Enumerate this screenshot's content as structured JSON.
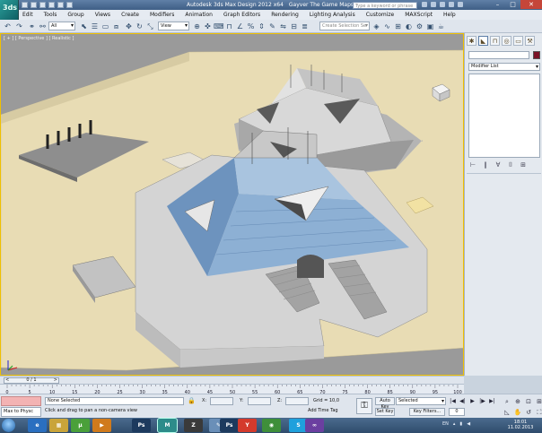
{
  "colors": {
    "title_bar": "#4a6a92",
    "viewport_bg": "#9a9a9a",
    "sand": "#e8dcb4",
    "pyramid_front_roof": "#8db0d4",
    "pyramid_back": "#d8d8d8",
    "active_viewport_border": "#f0c000",
    "object_color": "#7a1226"
  },
  "titlebar": {
    "app_icon_label": "3ds",
    "title": "Autodesk 3ds Max Design 2012 x64",
    "file": "Gayver The Game Maps 1.max",
    "search_placeholder": "Type a keyword or phrase",
    "window_buttons": {
      "minimize": "–",
      "maximize": "□",
      "close": "✕"
    }
  },
  "menu": [
    "Edit",
    "Tools",
    "Group",
    "Views",
    "Create",
    "Modifiers",
    "Animation",
    "Graph Editors",
    "Rendering",
    "Lighting Analysis",
    "Customize",
    "MAXScript",
    "Help"
  ],
  "toolbar": {
    "selection_filter": "All",
    "reference_coord": "View",
    "named_selection_placeholder": "Create Selection Se",
    "icons": [
      "undo-icon",
      "redo-icon",
      "select-link-icon",
      "unlink-icon",
      "bind-space-warp-icon",
      "select-icon",
      "select-by-name-icon",
      "rect-region-icon",
      "window-crossing-icon",
      "move-icon",
      "rotate-icon",
      "scale-icon",
      "pivot-icon",
      "select-manipulate-icon",
      "keyboard-shortcut-icon",
      "snaps-icon",
      "angle-snap-icon",
      "percent-snap-icon",
      "spinner-snap-icon",
      "edit-named-selection-icon",
      "mirror-icon",
      "align-icon",
      "layer-manager-icon",
      "graphite-icon",
      "curve-editor-icon",
      "schematic-view-icon",
      "material-editor-icon",
      "render-setup-icon",
      "rendered-frame-icon",
      "render-icon"
    ]
  },
  "viewport": {
    "label": "[ + ] [ Perspective ] [ Realistic ]"
  },
  "command_panel": {
    "tabs": [
      "create-tab",
      "modify-tab",
      "hierarchy-tab",
      "motion-tab",
      "display-tab",
      "utilities-tab"
    ],
    "modifier_list": "Modifier List",
    "stack_buttons": [
      "⊢",
      "‖",
      "∀",
      "⌷",
      "⊞"
    ]
  },
  "time_slider": {
    "position": "0 / 1"
  },
  "track_bar": {
    "ticks": [
      "0",
      "5",
      "10",
      "15",
      "20",
      "25",
      "30",
      "35",
      "40",
      "45",
      "50",
      "55",
      "60",
      "65",
      "70",
      "75",
      "80",
      "85",
      "90",
      "95",
      "100"
    ]
  },
  "status": {
    "listener_label": "Max to Physc",
    "selection": "None Selected",
    "prompt": "Click and drag to pan a non-camera view",
    "x_label": "X:",
    "y_label": "Y:",
    "z_label": "Z:",
    "grid": "Grid = 10,0",
    "add_time_tag": "Add Time Tag",
    "auto_key": "Auto Key",
    "set_key": "Set Key",
    "key_filters": "Key Filters...",
    "selected_set": "Selected",
    "frame": "0",
    "playback": [
      "|◀",
      "◀|",
      "▶",
      "|▶",
      "▶|"
    ],
    "nav_icons": [
      "zoom-icon",
      "zoom-all-icon",
      "zoom-extents-icon",
      "zoom-extents-all-icon",
      "fov-icon",
      "pan-icon",
      "orbit-icon",
      "maximize-viewport-icon"
    ]
  },
  "taskbar": {
    "apps": [
      "ie-icon",
      "explorer-icon",
      "utorrent-icon",
      "media-player-icon",
      "photoshop-icon",
      "3dsmax-icon",
      "zbrush-icon",
      "paint-icon",
      "photoshop-icon-2",
      "yandex-icon",
      "chrome-icon",
      "skype-icon",
      "visual-studio-icon"
    ],
    "app_labels": [
      "e",
      "▦",
      "µ",
      "▶",
      "Ps",
      "M",
      "Z",
      "✎",
      "Ps",
      "Y",
      "◉",
      "S",
      "∞"
    ],
    "language": "EN",
    "time": "18:01",
    "date": "11.02.2013"
  }
}
